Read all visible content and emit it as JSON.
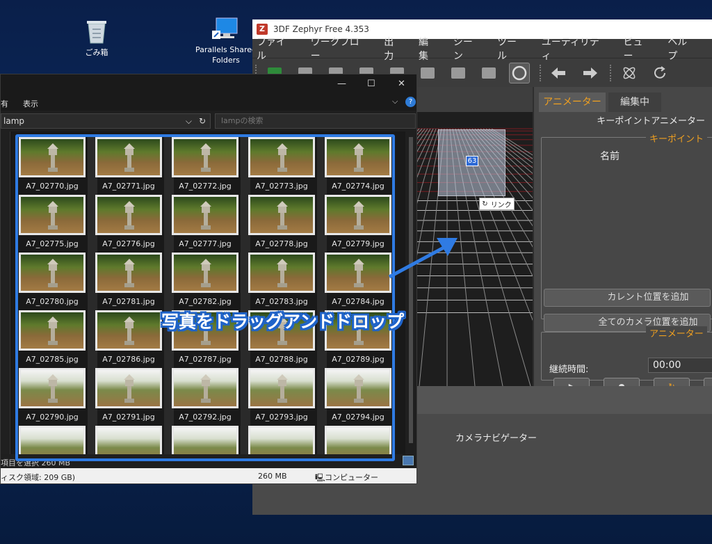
{
  "desktop": {
    "icons": [
      {
        "label": "ごみ箱"
      },
      {
        "label": "Parallels Shared Folders"
      }
    ]
  },
  "zephyr": {
    "title": "3DF Zephyr Free 4.353",
    "menu": [
      "ファイル",
      "ワークフロー",
      "出力",
      "編集",
      "シーン",
      "ツール",
      "ユーティリティ",
      "ビュー",
      "ヘルプ"
    ],
    "viewport": {
      "ghost_number": "63",
      "drop_tooltip": "リンク"
    },
    "panel": {
      "tabs": [
        "アニメーター",
        "編集中"
      ],
      "section_title": "キーポイントアニメーター",
      "keypoint_group": "キーポイント",
      "name_header": "名前",
      "add_current_button": "カレント位置を追加",
      "add_all_button": "全てのカメラ位置を追加",
      "animator_group": "アニメーター",
      "duration_label": "継続時間:",
      "duration_value": "00:00"
    },
    "camera_navigator": "カメラナビゲーター"
  },
  "explorer": {
    "ribbon": {
      "tab1": "有",
      "tab2": "表示"
    },
    "address": "lamp",
    "search_placeholder": "lampの検索",
    "files": [
      "A7_02770.jpg",
      "A7_02771.jpg",
      "A7_02772.jpg",
      "A7_02773.jpg",
      "A7_02774.jpg",
      "A7_02775.jpg",
      "A7_02776.jpg",
      "A7_02777.jpg",
      "A7_02778.jpg",
      "A7_02779.jpg",
      "A7_02780.jpg",
      "A7_02781.jpg",
      "A7_02782.jpg",
      "A7_02783.jpg",
      "A7_02784.jpg",
      "A7_02785.jpg",
      "A7_02786.jpg",
      "A7_02787.jpg",
      "A7_02788.jpg",
      "A7_02789.jpg",
      "A7_02790.jpg",
      "A7_02791.jpg",
      "A7_02792.jpg",
      "A7_02793.jpg",
      "A7_02794.jpg"
    ],
    "status": "項目を選択  260 MB",
    "footer": {
      "disk": "ィスク領域: 209 GB)",
      "size": "260 MB",
      "location": "コンピューター"
    }
  },
  "annotation": {
    "text": "写真をドラッグアンドドロップ",
    "color": "#2f7be3"
  }
}
